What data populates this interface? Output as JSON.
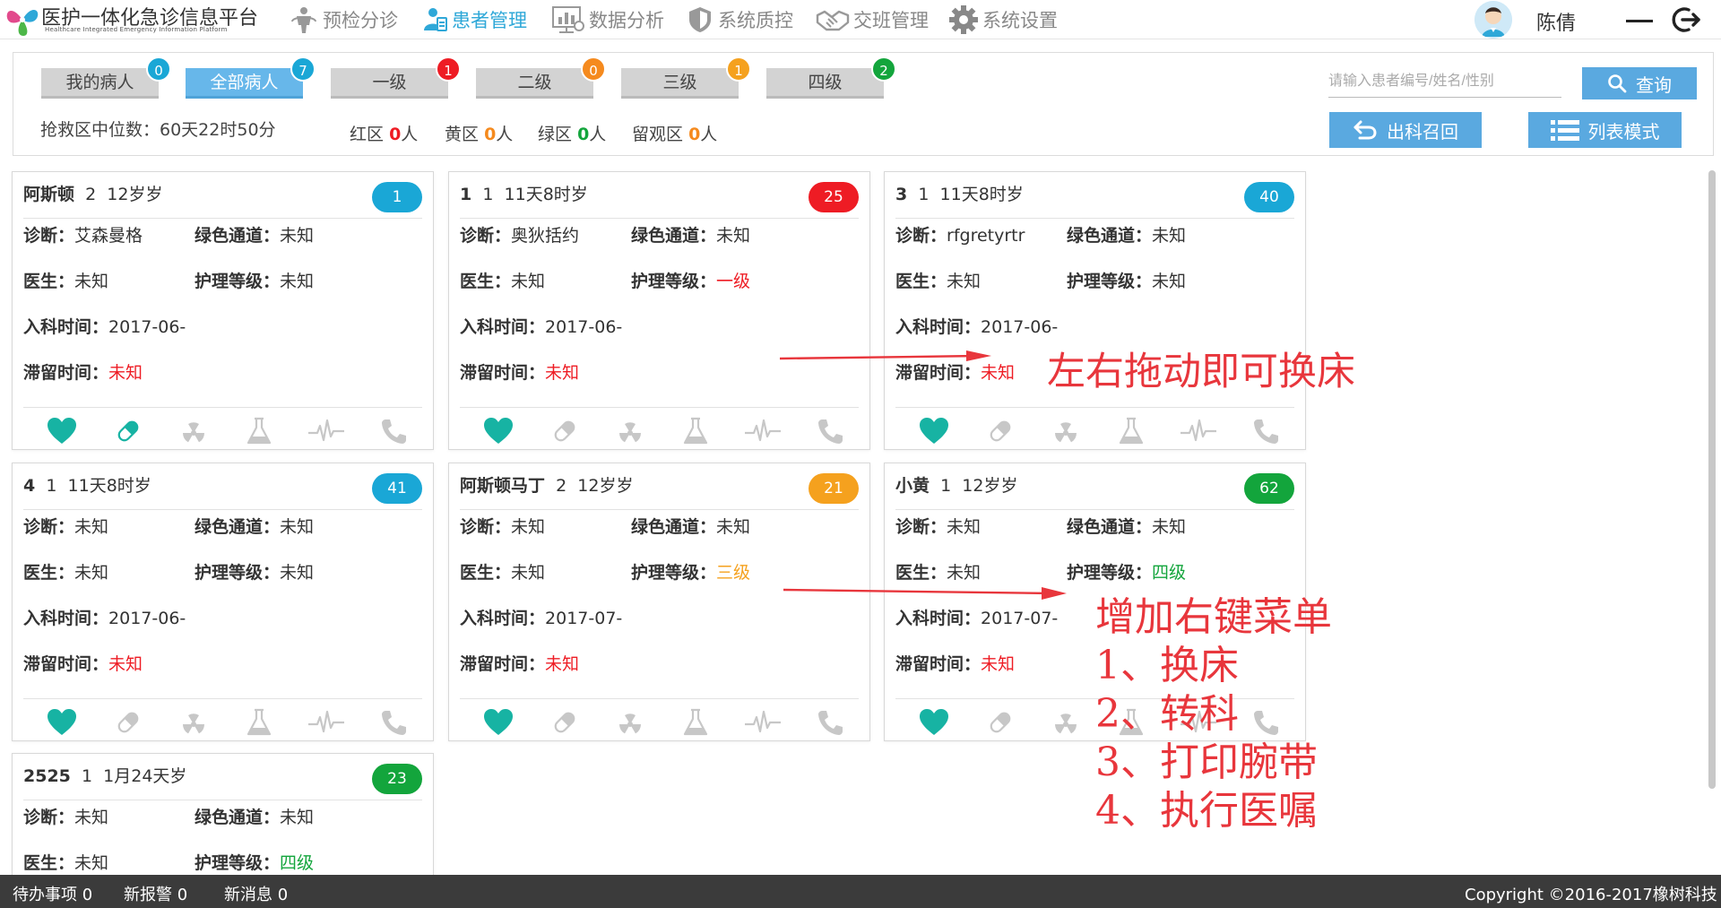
{
  "header": {
    "app_title": "医护一体化急诊信息平台",
    "app_subtitle": "Healthcare Integrated Emergency Information Platform",
    "nav": [
      {
        "label": "预检分诊",
        "icon": "triage-person-icon",
        "active": false
      },
      {
        "label": "患者管理",
        "icon": "patient-management-icon",
        "active": true
      },
      {
        "label": "数据分析",
        "icon": "data-analysis-icon",
        "active": false
      },
      {
        "label": "系统质控",
        "icon": "shield-icon",
        "active": false
      },
      {
        "label": "交班管理",
        "icon": "handshake-icon",
        "active": false
      },
      {
        "label": "系统设置",
        "icon": "gear-icon",
        "active": false
      }
    ],
    "user_name": "陈倩"
  },
  "filters": {
    "tabs": [
      {
        "label": "我的病人",
        "count": "0",
        "badge_color": "#1aa7d6",
        "selected": false
      },
      {
        "label": "全部病人",
        "count": "7",
        "badge_color": "#1aa7d6",
        "selected": true
      },
      {
        "label": "一级",
        "count": "1",
        "badge_color": "#ee1c24",
        "selected": false
      },
      {
        "label": "二级",
        "count": "0",
        "badge_color": "#f58a1e",
        "selected": false
      },
      {
        "label": "三级",
        "count": "1",
        "badge_color": "#f5a11e",
        "selected": false
      },
      {
        "label": "四级",
        "count": "2",
        "badge_color": "#13a53c",
        "selected": false
      }
    ],
    "median_label": "抢救区中位数：60天22时50分",
    "zones": [
      {
        "name": "红区",
        "count": "0",
        "unit": "人",
        "color": "#ee1c24"
      },
      {
        "name": "黄区",
        "count": "0",
        "unit": "人",
        "color": "#f58a1e"
      },
      {
        "name": "绿区",
        "count": "0",
        "unit": "人",
        "color": "#13a53c"
      },
      {
        "name": "留观区",
        "count": "0",
        "unit": "人",
        "color": "#f58a1e"
      }
    ],
    "search_placeholder": "请输入患者编号/姓名/性别",
    "search_button": "查询",
    "recall_button": "出科召回",
    "list_mode_button": "列表模式"
  },
  "labels": {
    "diagnosis": "诊断：",
    "green_channel": "绿色通道：",
    "doctor": "医生：",
    "nursing_level": "护理等级：",
    "admission_time": "入科时间：",
    "stay_time": "滞留时间："
  },
  "colors": {
    "badge_cyan": "#1aa7d6",
    "badge_red": "#ee1c24",
    "badge_orange": "#f5a11e",
    "badge_green": "#13a53c",
    "icon_active": "#17b3a3",
    "icon_inactive": "#c7c7c7",
    "text_red": "#ee1c24",
    "text_orange": "#f5a11e",
    "text_green": "#13a53c"
  },
  "patients": [
    {
      "name": "阿斯顿",
      "gender": "2",
      "age": "12岁岁",
      "bed": "1",
      "bed_color": "#1aa7d6",
      "diagnosis": "艾森曼格",
      "green_channel": "未知",
      "doctor": "未知",
      "nursing_level": "未知",
      "nursing_color": "#333333",
      "admission": "2017-06-",
      "stay": "未知",
      "pill_active": true
    },
    {
      "name": "1",
      "gender": "1",
      "age": "11天8时岁",
      "bed": "25",
      "bed_color": "#ee1c24",
      "diagnosis": "奥狄括约",
      "green_channel": "未知",
      "doctor": "未知",
      "nursing_level": "一级",
      "nursing_color": "#ee1c24",
      "admission": "2017-06-",
      "stay": "未知",
      "pill_active": false
    },
    {
      "name": "3",
      "gender": "1",
      "age": "11天8时岁",
      "bed": "40",
      "bed_color": "#1aa7d6",
      "diagnosis": "rfgretyrtr",
      "green_channel": "未知",
      "doctor": "未知",
      "nursing_level": "未知",
      "nursing_color": "#333333",
      "admission": "2017-06-",
      "stay": "未知",
      "pill_active": false
    },
    {
      "name": "4",
      "gender": "1",
      "age": "11天8时岁",
      "bed": "41",
      "bed_color": "#1aa7d6",
      "diagnosis": "未知",
      "green_channel": "未知",
      "doctor": "未知",
      "nursing_level": "未知",
      "nursing_color": "#333333",
      "admission": "2017-06-",
      "stay": "未知",
      "pill_active": false
    },
    {
      "name": "阿斯顿马丁",
      "gender": "2",
      "age": "12岁岁",
      "bed": "21",
      "bed_color": "#f5a11e",
      "diagnosis": "未知",
      "green_channel": "未知",
      "doctor": "未知",
      "nursing_level": "三级",
      "nursing_color": "#f5a11e",
      "admission": "2017-07-",
      "stay": "未知",
      "pill_active": false
    },
    {
      "name": "小黄",
      "gender": "1",
      "age": "12岁岁",
      "bed": "62",
      "bed_color": "#13a53c",
      "diagnosis": "未知",
      "green_channel": "未知",
      "doctor": "未知",
      "nursing_level": "四级",
      "nursing_color": "#13a53c",
      "admission": "2017-07-",
      "stay": "未知",
      "pill_active": false
    },
    {
      "name": "2525",
      "gender": "1",
      "age": "1月24天岁",
      "bed": "23",
      "bed_color": "#13a53c",
      "diagnosis": "未知",
      "green_channel": "未知",
      "doctor": "未知",
      "nursing_level": "四级",
      "nursing_color": "#13a53c",
      "admission": "",
      "stay": "",
      "pill_active": false
    }
  ],
  "card_icons": [
    "heart-icon",
    "pill-icon",
    "radiation-icon",
    "flask-icon",
    "pulse-icon",
    "phone-icon"
  ],
  "annotations": {
    "drag_note": "左右拖动即可换床",
    "menu_title": "增加右键菜单",
    "menu_items": [
      "1、换床",
      "2、转科",
      "3、打印腕带",
      "4、执行医嘱"
    ]
  },
  "statusbar": {
    "todo": "待办事项 0",
    "alarms": "新报警 0",
    "messages": "新消息 0",
    "copyright": "Copyright ©2016-2017橡树科技"
  }
}
